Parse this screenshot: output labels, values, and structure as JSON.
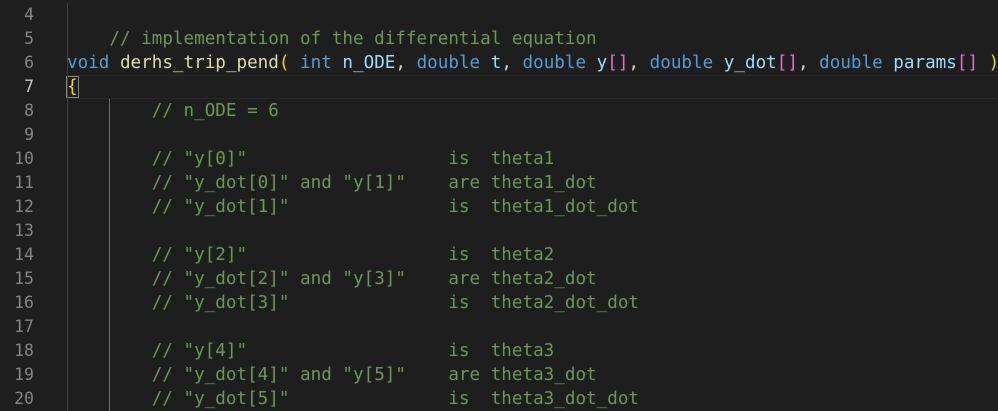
{
  "editor": {
    "lines": [
      {
        "number": "4",
        "tokens": []
      },
      {
        "number": "5",
        "tokens": [
          {
            "text": "    ",
            "cls": "punc"
          },
          {
            "text": "// implementation of the differential equation",
            "cls": "cmt"
          }
        ]
      },
      {
        "number": "6",
        "tokens": [
          {
            "text": "void",
            "cls": "kw"
          },
          {
            "text": " ",
            "cls": "punc"
          },
          {
            "text": "derhs_trip_pend",
            "cls": "fn"
          },
          {
            "text": "( ",
            "cls": "brk1"
          },
          {
            "text": "int",
            "cls": "kw"
          },
          {
            "text": " ",
            "cls": "punc"
          },
          {
            "text": "n_ODE",
            "cls": "var"
          },
          {
            "text": ", ",
            "cls": "punc"
          },
          {
            "text": "double",
            "cls": "kw"
          },
          {
            "text": " ",
            "cls": "punc"
          },
          {
            "text": "t",
            "cls": "var"
          },
          {
            "text": ", ",
            "cls": "punc"
          },
          {
            "text": "double",
            "cls": "kw"
          },
          {
            "text": " ",
            "cls": "punc"
          },
          {
            "text": "y",
            "cls": "var"
          },
          {
            "text": "[]",
            "cls": "brk2"
          },
          {
            "text": ", ",
            "cls": "punc"
          },
          {
            "text": "double",
            "cls": "kw"
          },
          {
            "text": " ",
            "cls": "punc"
          },
          {
            "text": "y_dot",
            "cls": "var"
          },
          {
            "text": "[]",
            "cls": "brk2"
          },
          {
            "text": ", ",
            "cls": "punc"
          },
          {
            "text": "double",
            "cls": "kw"
          },
          {
            "text": " ",
            "cls": "punc"
          },
          {
            "text": "params",
            "cls": "var"
          },
          {
            "text": "[]",
            "cls": "brk2"
          },
          {
            "text": " )",
            "cls": "brk1"
          }
        ]
      },
      {
        "number": "7",
        "tokens": [
          {
            "text": "{",
            "cls": "brk1 brace-match"
          }
        ]
      },
      {
        "number": "8",
        "tokens": [
          {
            "text": "        ",
            "cls": "punc"
          },
          {
            "text": "// n_ODE = 6",
            "cls": "cmt"
          }
        ]
      },
      {
        "number": "9",
        "tokens": []
      },
      {
        "number": "10",
        "tokens": [
          {
            "text": "        ",
            "cls": "punc"
          },
          {
            "text": "// \"y[0]\"                   is  theta1",
            "cls": "cmt"
          }
        ]
      },
      {
        "number": "11",
        "tokens": [
          {
            "text": "        ",
            "cls": "punc"
          },
          {
            "text": "// \"y_dot[0]\" and \"y[1]\"    are theta1_dot",
            "cls": "cmt"
          }
        ]
      },
      {
        "number": "12",
        "tokens": [
          {
            "text": "        ",
            "cls": "punc"
          },
          {
            "text": "// \"y_dot[1]\"               is  theta1_dot_dot",
            "cls": "cmt"
          }
        ]
      },
      {
        "number": "13",
        "tokens": []
      },
      {
        "number": "14",
        "tokens": [
          {
            "text": "        ",
            "cls": "punc"
          },
          {
            "text": "// \"y[2]\"                   is  theta2",
            "cls": "cmt"
          }
        ]
      },
      {
        "number": "15",
        "tokens": [
          {
            "text": "        ",
            "cls": "punc"
          },
          {
            "text": "// \"y_dot[2]\" and \"y[3]\"    are theta2_dot",
            "cls": "cmt"
          }
        ]
      },
      {
        "number": "16",
        "tokens": [
          {
            "text": "        ",
            "cls": "punc"
          },
          {
            "text": "// \"y_dot[3]\"               is  theta2_dot_dot",
            "cls": "cmt"
          }
        ]
      },
      {
        "number": "17",
        "tokens": []
      },
      {
        "number": "18",
        "tokens": [
          {
            "text": "        ",
            "cls": "punc"
          },
          {
            "text": "// \"y[4]\"                   is  theta3",
            "cls": "cmt"
          }
        ]
      },
      {
        "number": "19",
        "tokens": [
          {
            "text": "        ",
            "cls": "punc"
          },
          {
            "text": "// \"y_dot[4]\" and \"y[5]\"    are theta3_dot",
            "cls": "cmt"
          }
        ]
      },
      {
        "number": "20",
        "tokens": [
          {
            "text": "        ",
            "cls": "punc"
          },
          {
            "text": "// \"y_dot[5]\"               is  theta3_dot_dot",
            "cls": "cmt"
          }
        ]
      }
    ]
  },
  "colors": {
    "background": "#1e1e1e",
    "comment": "#6a9955",
    "keyword": "#569cd6",
    "function": "#dcdcaa",
    "variable": "#9cdcfe",
    "bracket_level1": "#ffd700",
    "bracket_level2": "#da70d6",
    "line_number": "#858585"
  }
}
